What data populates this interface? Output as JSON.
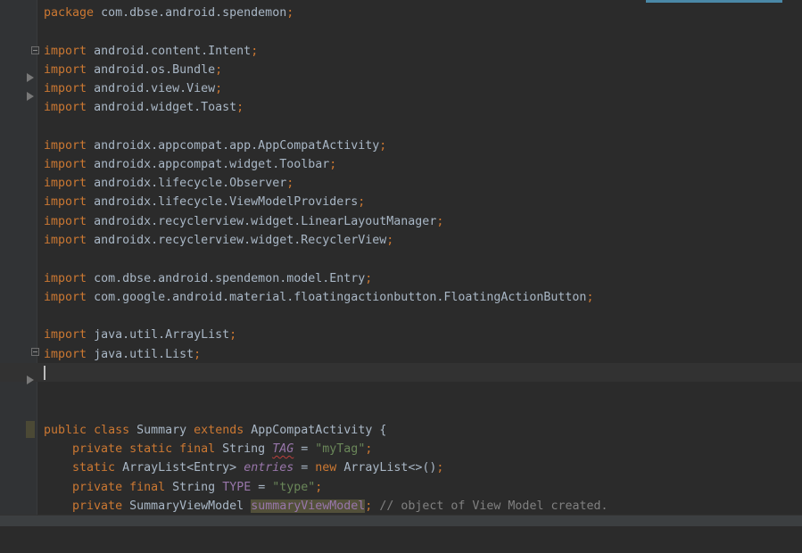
{
  "editor": {
    "package_line": {
      "keyword": "package",
      "name": "com.dbse.android.spendemon",
      "semi": ";"
    },
    "imports": [
      {
        "keyword": "import",
        "name": "android.content.Intent",
        "semi": ";"
      },
      {
        "keyword": "import",
        "name": "android.os.Bundle",
        "semi": ";"
      },
      {
        "keyword": "import",
        "name": "android.view.View",
        "semi": ";"
      },
      {
        "keyword": "import",
        "name": "android.widget.Toast",
        "semi": ";"
      },
      {
        "keyword": "import",
        "name": "androidx.appcompat.app.AppCompatActivity",
        "semi": ";"
      },
      {
        "keyword": "import",
        "name": "androidx.appcompat.widget.Toolbar",
        "semi": ";"
      },
      {
        "keyword": "import",
        "name": "androidx.lifecycle.Observer",
        "semi": ";"
      },
      {
        "keyword": "import",
        "name": "androidx.lifecycle.ViewModelProviders",
        "semi": ";"
      },
      {
        "keyword": "import",
        "name": "androidx.recyclerview.widget.LinearLayoutManager",
        "semi": ";"
      },
      {
        "keyword": "import",
        "name": "androidx.recyclerview.widget.RecyclerView",
        "semi": ";"
      },
      {
        "keyword": "import",
        "name": "com.dbse.android.spendemon.model.Entry",
        "semi": ";"
      },
      {
        "keyword": "import",
        "name": "com.google.android.material.floatingactionbutton.FloatingActionButton",
        "semi": ";"
      },
      {
        "keyword": "import",
        "name": "java.util.ArrayList",
        "semi": ";"
      },
      {
        "keyword": "import",
        "name": "java.util.List",
        "semi": ";"
      }
    ],
    "class_decl": {
      "mod": "public",
      "kw_class": "class",
      "name": "Summary",
      "kw_extends": "extends",
      "parent": "AppCompatActivity",
      "brace": " {"
    },
    "field1": {
      "mods": "private static final",
      "type": "String",
      "name": "TAG",
      "eq": " = ",
      "value": "\"myTag\"",
      "semi": ";"
    },
    "field2": {
      "mods": "static",
      "type": "ArrayList<Entry>",
      "name": "entries",
      "eq": " = ",
      "kw_new": "new",
      "ctor": "ArrayList<>()",
      "semi": ";"
    },
    "field3": {
      "mods": "private final",
      "type": "String",
      "name": "TYPE",
      "eq": " = ",
      "value": "\"type\"",
      "semi": ";"
    },
    "field4": {
      "mods": "private",
      "type": "SummaryViewModel",
      "name": "summaryViewModel",
      "semi": ";",
      "comment": "// object of View Model created."
    }
  },
  "colors": {
    "background": "#2b2b2b",
    "keyword": "#cc7832",
    "string": "#6a8759",
    "field": "#9876aa",
    "comment": "#808080",
    "text": "#a9b7c6"
  }
}
